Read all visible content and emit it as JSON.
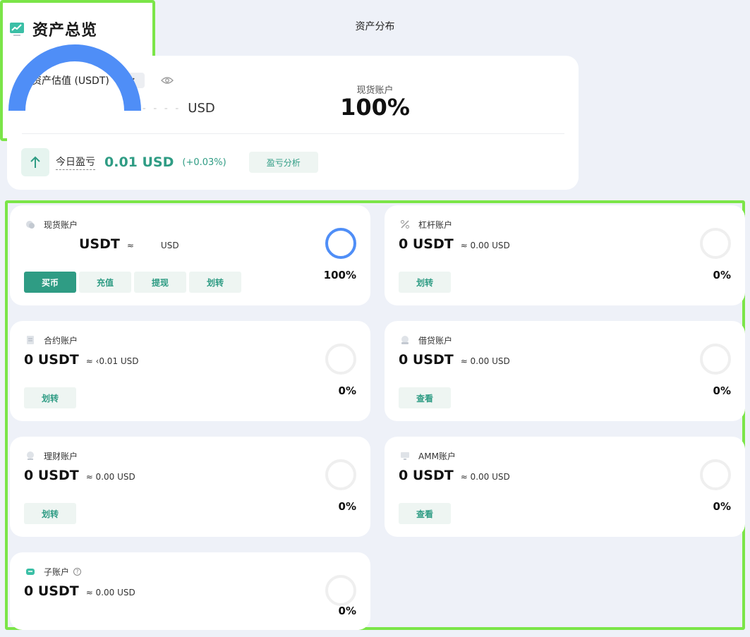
{
  "header": {
    "title": "资产总览",
    "icon": "chart-trend-icon"
  },
  "summary": {
    "label": "总资产估值 (USDT)",
    "approx": "≈",
    "masked": "- - - -",
    "currency": "USD",
    "pnl_label": "今日盈亏",
    "pnl_value": "0.01 USD",
    "pnl_pct": "(+0.03%)",
    "pnl_button": "盈亏分析"
  },
  "distribution": {
    "title": "资产分布",
    "account": "现货账户",
    "percent": "100%",
    "value": 100,
    "color": "#4f8ef7"
  },
  "accounts": [
    {
      "name": "现货账户",
      "icon": "spot-account-icon",
      "balance": "USDT",
      "approx": "≈",
      "usd": "USD",
      "percent": "100%",
      "share": 100,
      "buttons": [
        "买币",
        "充值",
        "提现",
        "划转"
      ]
    },
    {
      "name": "杠杆账户",
      "icon": "margin-account-icon",
      "balance": "0 USDT",
      "approx": "≈ 0.00 USD",
      "percent": "0%",
      "share": 0,
      "buttons": [
        "划转"
      ]
    },
    {
      "name": "合约账户",
      "icon": "futures-account-icon",
      "balance": "0 USDT",
      "approx": "≈ ‹0.01 USD",
      "percent": "0%",
      "share": 0,
      "buttons": [
        "划转"
      ]
    },
    {
      "name": "借贷账户",
      "icon": "loan-account-icon",
      "balance": "0 USDT",
      "approx": "≈ 0.00 USD",
      "percent": "0%",
      "share": 0,
      "buttons": [
        "查看"
      ]
    },
    {
      "name": "理财账户",
      "icon": "earn-account-icon",
      "balance": "0 USDT",
      "approx": "≈ 0.00 USD",
      "percent": "0%",
      "share": 0,
      "buttons": [
        "划转"
      ]
    },
    {
      "name": "AMM账户",
      "icon": "amm-account-icon",
      "balance": "0 USDT",
      "approx": "≈ 0.00 USD",
      "percent": "0%",
      "share": 0,
      "buttons": [
        "查看"
      ]
    },
    {
      "name": "子账户",
      "icon": "sub-account-icon",
      "balance": "0 USDT",
      "approx": "≈ 0.00 USD",
      "percent": "0%",
      "share": 0,
      "buttons": []
    }
  ],
  "colors": {
    "accent": "#2f9c84",
    "ring_active": "#4f8ef7",
    "ring_empty": "#efefef",
    "highlight": "#7be548"
  }
}
